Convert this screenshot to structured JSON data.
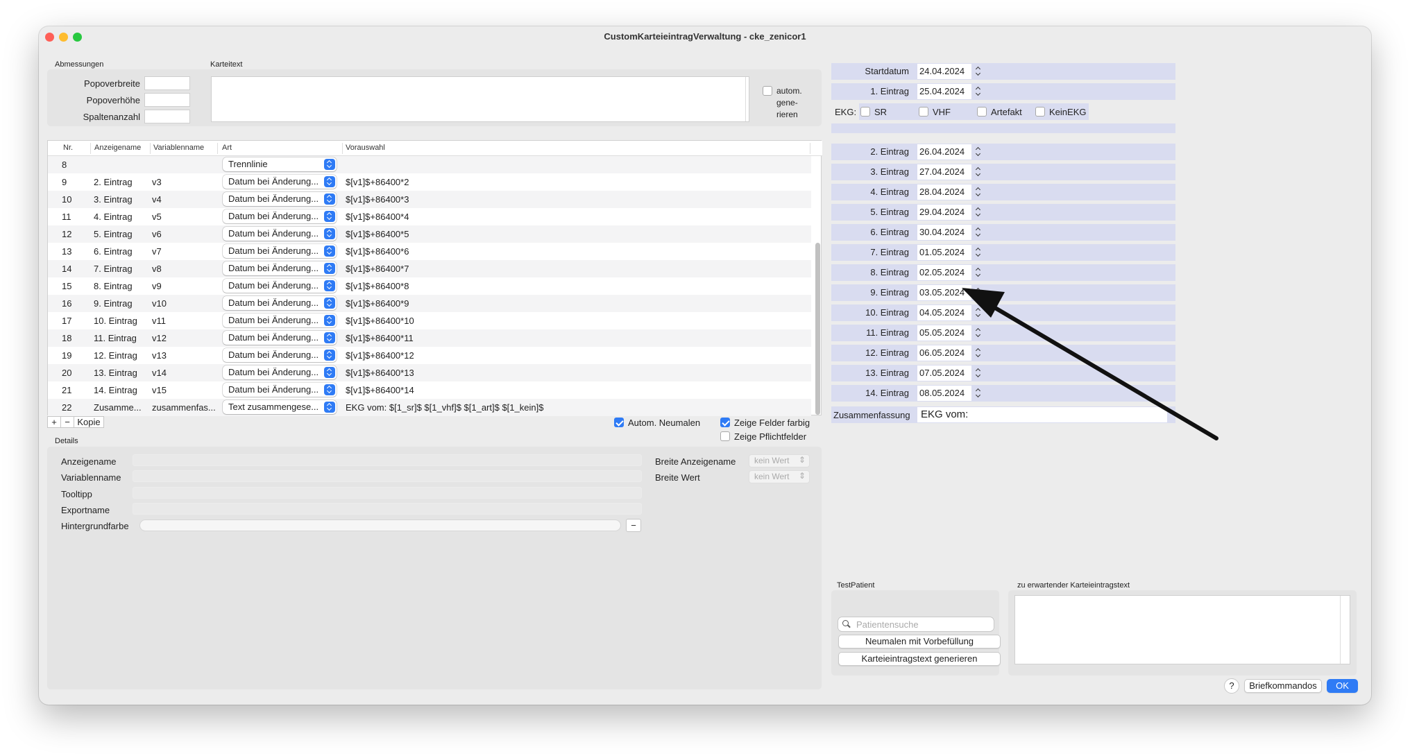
{
  "window": {
    "title": "CustomKarteieintragVerwaltung - cke_zenicor1",
    "traffic": [
      "#fe5f57",
      "#febc2e",
      "#28c840"
    ]
  },
  "abmessungen": {
    "group": "Abmessungen",
    "labels": [
      "Popoverbreite",
      "Popoverhöhe",
      "Spaltenanzahl"
    ]
  },
  "karteitext": {
    "group": "Karteitext",
    "autom": "autom. gene- rieren",
    "autom_lines": [
      "autom.",
      "gene-",
      "rieren"
    ]
  },
  "table": {
    "headers": [
      "Nr.",
      "Anzeigename",
      "Variablenname",
      "Art",
      "Vorauswahl"
    ],
    "rows": [
      {
        "nr": "8",
        "anz": "",
        "var": "",
        "art": "Trennlinie",
        "vor": ""
      },
      {
        "nr": "9",
        "anz": "2. Eintrag",
        "var": "v3",
        "art": "Datum bei Änderung...",
        "vor": "$[v1]$+86400*2"
      },
      {
        "nr": "10",
        "anz": "3. Eintrag",
        "var": "v4",
        "art": "Datum bei Änderung...",
        "vor": "$[v1]$+86400*3"
      },
      {
        "nr": "11",
        "anz": "4. Eintrag",
        "var": "v5",
        "art": "Datum bei Änderung...",
        "vor": "$[v1]$+86400*4"
      },
      {
        "nr": "12",
        "anz": "5. Eintrag",
        "var": "v6",
        "art": "Datum bei Änderung...",
        "vor": "$[v1]$+86400*5"
      },
      {
        "nr": "13",
        "anz": "6. Eintrag",
        "var": "v7",
        "art": "Datum bei Änderung...",
        "vor": "$[v1]$+86400*6"
      },
      {
        "nr": "14",
        "anz": "7. Eintrag",
        "var": "v8",
        "art": "Datum bei Änderung...",
        "vor": "$[v1]$+86400*7"
      },
      {
        "nr": "15",
        "anz": "8. Eintrag",
        "var": "v9",
        "art": "Datum bei Änderung...",
        "vor": "$[v1]$+86400*8"
      },
      {
        "nr": "16",
        "anz": "9. Eintrag",
        "var": "v10",
        "art": "Datum bei Änderung...",
        "vor": "$[v1]$+86400*9"
      },
      {
        "nr": "17",
        "anz": "10. Eintrag",
        "var": "v11",
        "art": "Datum bei Änderung...",
        "vor": "$[v1]$+86400*10"
      },
      {
        "nr": "18",
        "anz": "11. Eintrag",
        "var": "v12",
        "art": "Datum bei Änderung...",
        "vor": "$[v1]$+86400*11"
      },
      {
        "nr": "19",
        "anz": "12. Eintrag",
        "var": "v13",
        "art": "Datum bei Änderung...",
        "vor": "$[v1]$+86400*12"
      },
      {
        "nr": "20",
        "anz": "13. Eintrag",
        "var": "v14",
        "art": "Datum bei Änderung...",
        "vor": "$[v1]$+86400*13"
      },
      {
        "nr": "21",
        "anz": "14. Eintrag",
        "var": "v15",
        "art": "Datum bei Änderung...",
        "vor": "$[v1]$+86400*14"
      },
      {
        "nr": "22",
        "anz": "Zusamme...",
        "var": "zusammenfas...",
        "art": "Text zusammengese...",
        "vor": "EKG vom: $[1_sr]$ $[1_vhf]$ $[1_art]$ $[1_kein]$"
      }
    ]
  },
  "toolbar": {
    "plus": "+",
    "minus": "−",
    "kopie": "Kopie",
    "autom_neumalen": "Autom. Neumalen",
    "zeige_farbig": "Zeige Felder farbig",
    "zeige_pflicht": "Zeige Pflichtfelder"
  },
  "details": {
    "group": "Details",
    "labels": [
      "Anzeigename",
      "Variablenname",
      "Tooltipp",
      "Exportname",
      "Hintergrundfarbe"
    ],
    "breite_anz": "Breite Anzeigename",
    "breite_wert": "Breite Wert",
    "kein_wert": "kein Wert",
    "minus": "−"
  },
  "preview": {
    "startdatum": {
      "label": "Startdatum",
      "value": "24.04.2024"
    },
    "eintrag1": {
      "label": "1. Eintrag",
      "value": "25.04.2024"
    },
    "ekg": {
      "label": "EKG:",
      "options": [
        "SR",
        "VHF",
        "Artefakt",
        "KeinEKG"
      ]
    },
    "entries": [
      {
        "label": "2. Eintrag",
        "value": "26.04.2024"
      },
      {
        "label": "3. Eintrag",
        "value": "27.04.2024"
      },
      {
        "label": "4. Eintrag",
        "value": "28.04.2024"
      },
      {
        "label": "5. Eintrag",
        "value": "29.04.2024"
      },
      {
        "label": "6. Eintrag",
        "value": "30.04.2024"
      },
      {
        "label": "7. Eintrag",
        "value": "01.05.2024"
      },
      {
        "label": "8. Eintrag",
        "value": "02.05.2024"
      },
      {
        "label": "9. Eintrag",
        "value": "03.05.2024"
      },
      {
        "label": "10. Eintrag",
        "value": "04.05.2024"
      },
      {
        "label": "11. Eintrag",
        "value": "05.05.2024"
      },
      {
        "label": "12. Eintrag",
        "value": "06.05.2024"
      },
      {
        "label": "13. Eintrag",
        "value": "07.05.2024"
      },
      {
        "label": "14. Eintrag",
        "value": "08.05.2024"
      }
    ],
    "zusammenfassung": {
      "label": "Zusammenfassung",
      "value": "EKG vom:"
    },
    "row_color": "#d9dcf0"
  },
  "testpatient": {
    "group": "TestPatient",
    "search_placeholder": "Patientensuche",
    "neumalen": "Neumalen mit Vorbefüllung",
    "generieren": "Karteieintragstext generieren"
  },
  "expected": {
    "group": "zu erwartender Karteieintragstext"
  },
  "footer": {
    "help": "?",
    "brief": "Briefkommandos",
    "ok": "OK",
    "accent": "#2f7bf5"
  }
}
